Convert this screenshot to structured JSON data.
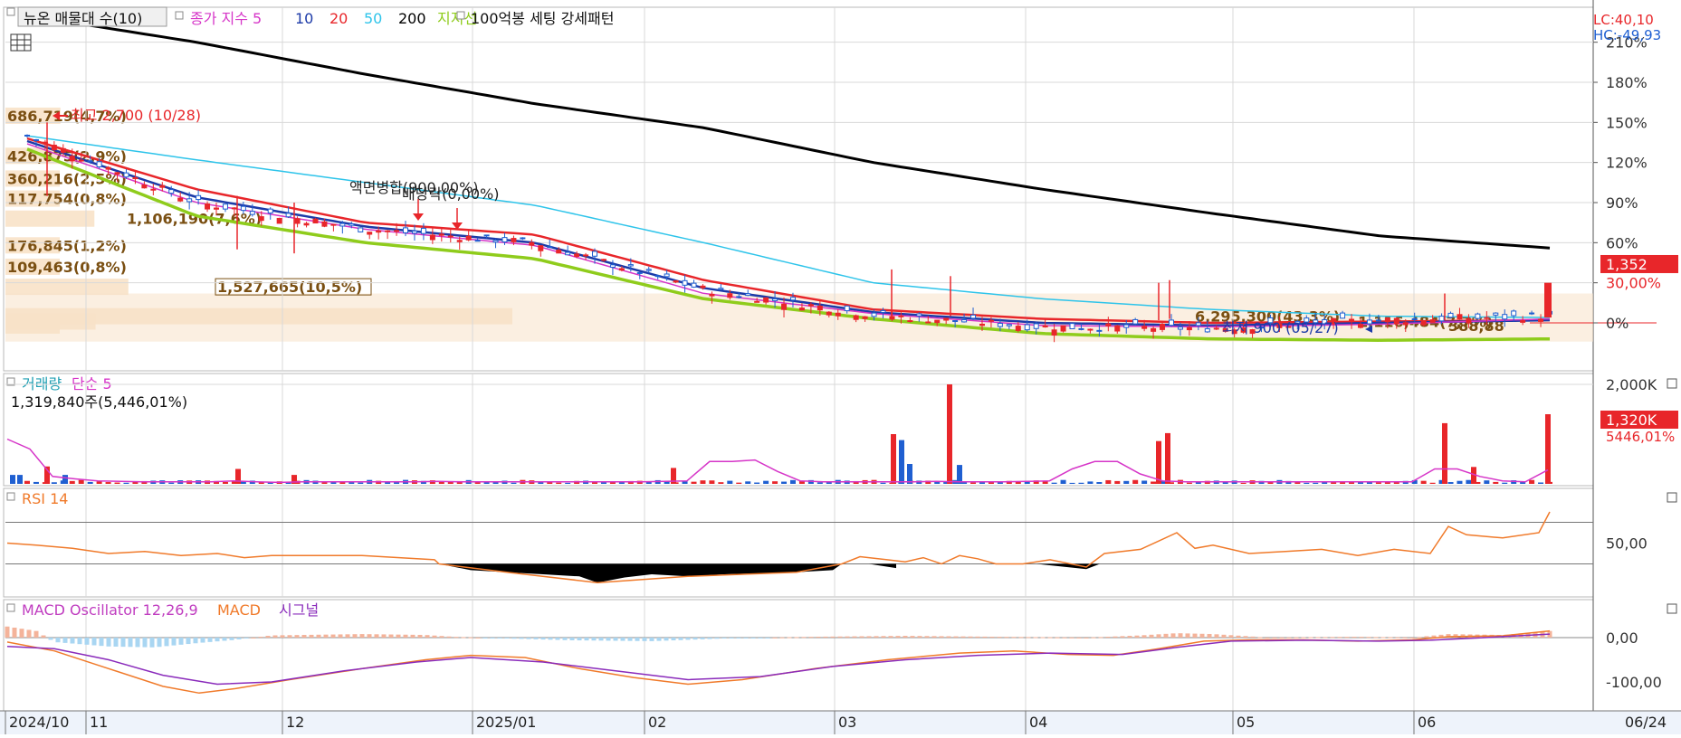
{
  "colors": {
    "price_up": "#e8262a",
    "price_down": "#1f5fd1",
    "ma5": "#d635c8",
    "ma10": "#1c3aa8",
    "ma20": "#e8262a",
    "ma50": "#2ec4ea",
    "ma200": "#000000",
    "support": "#8fcc1c",
    "volume_ma": "#d635c8",
    "rsi_line": "#f07a2a",
    "macd_line": "#f07a2a",
    "signal_line": "#8a2bbb",
    "osc_pos": "#f4b39a",
    "osc_neg": "#a9d6f2",
    "profile_fill": "#f8e2c8",
    "profile_text": "#7a4f12",
    "axis_bg": "#eef3fb",
    "grid": "#d9d9d9"
  },
  "price_panel": {
    "title": "뉴온 매물대 수(10)",
    "legend": [
      {
        "label": "종가 지수 5",
        "color": "#d635c8"
      },
      {
        "label": "10",
        "color": "#1c3aa8"
      },
      {
        "label": "20",
        "color": "#e8262a"
      },
      {
        "label": "50",
        "color": "#2ec4ea"
      },
      {
        "label": "200",
        "color": "#000000"
      },
      {
        "label": "지지선",
        "color": "#8fcc1c"
      }
    ],
    "extra_label": "100억봉 세팅 강세패턴",
    "lc_label": "LC:40,10",
    "hc_label": "HC:-49,93",
    "y_ticks": [
      "210%",
      "180%",
      "150%",
      "120%",
      "90%",
      "60%",
      "30,00%",
      "0%"
    ],
    "current_price_tag": "1,352",
    "high_annotation": "최고 2,700 (10/28)",
    "low_annotation": "최저 900 (05/27)",
    "event_annotations": [
      "액면병합(900,00%)",
      "배당락(0,00%)"
    ],
    "volume_profile": [
      {
        "label": "686,719(4,7%)",
        "pct": 4.7,
        "level": 155
      },
      {
        "label": "426,875(2,9%)",
        "pct": 2.9,
        "level": 125
      },
      {
        "label": "360,216(2,5%)",
        "pct": 2.5,
        "level": 108
      },
      {
        "label": "117,754(0,8%)",
        "pct": 0.8,
        "level": 93
      },
      {
        "label": "1,106,190(7,6%)",
        "pct": 7.6,
        "level": 78
      },
      {
        "label": "176,845(1,2%)",
        "pct": 1.2,
        "level": 58
      },
      {
        "label": "109,463(0,8%)",
        "pct": 0.8,
        "level": 42
      },
      {
        "label": "1,527,665(10,5%)",
        "pct": 10.5,
        "level": 27
      },
      {
        "label": "6,295,300(43,3%)",
        "pct": 43.3,
        "level": 5
      },
      {
        "label": "1,116,484(7,7%)",
        "pct": 7.7,
        "level": 1
      },
      {
        "label": "388,88",
        "pct": 2.7,
        "level": -2
      }
    ]
  },
  "volume_panel": {
    "title": "거래량",
    "ma_label": "단순 5",
    "info": "1,319,840주(5,446,01%)",
    "y_tick": "2,000K",
    "current_tag": "1,320K",
    "pct_tag": "5446,01%"
  },
  "rsi_panel": {
    "title": "RSI 14",
    "y_tick": "50,00"
  },
  "macd_panel": {
    "title": "MACD Oscillator 12,26,9",
    "macd_label": "MACD",
    "signal_label": "시그널",
    "y_ticks": [
      "0,00",
      "-100,00"
    ]
  },
  "x_axis": {
    "labels": [
      "2024/10",
      "11",
      "12",
      "2025/01",
      "02",
      "03",
      "04",
      "05",
      "06"
    ],
    "current_date": "06/24"
  },
  "chart_data": {
    "type": "line",
    "title": "뉴온 매물대 수(10)",
    "x": [
      "2024/10",
      "11",
      "12",
      "2025/01",
      "02",
      "03",
      "04",
      "05",
      "06",
      "06/24"
    ],
    "ylim": [
      -30,
      220
    ],
    "y_unit": "%",
    "series": [
      {
        "name": "200",
        "values": [
          230,
          210,
          186,
          164,
          146,
          120,
          100,
          82,
          65,
          56
        ]
      },
      {
        "name": "50",
        "values": [
          140,
          122,
          105,
          88,
          60,
          30,
          18,
          10,
          5,
          4
        ]
      },
      {
        "name": "20",
        "values": [
          138,
          100,
          75,
          66,
          32,
          10,
          3,
          0,
          1,
          2
        ]
      },
      {
        "name": "10",
        "values": [
          136,
          94,
          72,
          60,
          26,
          8,
          0,
          -2,
          0,
          2
        ]
      },
      {
        "name": "종가 지수 5",
        "values": [
          134,
          90,
          70,
          58,
          22,
          7,
          -2,
          -3,
          -1,
          3
        ]
      },
      {
        "name": "지지선",
        "values": [
          130,
          80,
          60,
          48,
          18,
          3,
          -8,
          -12,
          -13,
          -12
        ]
      }
    ],
    "price_close_pct": [
      140,
      90,
      70,
      60,
      25,
      6,
      -3,
      -4,
      2,
      5
    ],
    "high": 2700,
    "low": 900,
    "last_price": 1352,
    "volume_k": [
      60,
      40,
      15,
      10,
      10,
      340,
      1320,
      320,
      580,
      1320
    ],
    "rsi": [
      52,
      45,
      40,
      40,
      10,
      40,
      55,
      50,
      55,
      80
    ],
    "macd": [
      -30,
      -130,
      -80,
      -40,
      -110,
      -60,
      -30,
      -10,
      0,
      10
    ],
    "signal": [
      -20,
      -110,
      -90,
      -50,
      -100,
      -70,
      -35,
      -15,
      -5,
      5
    ]
  }
}
